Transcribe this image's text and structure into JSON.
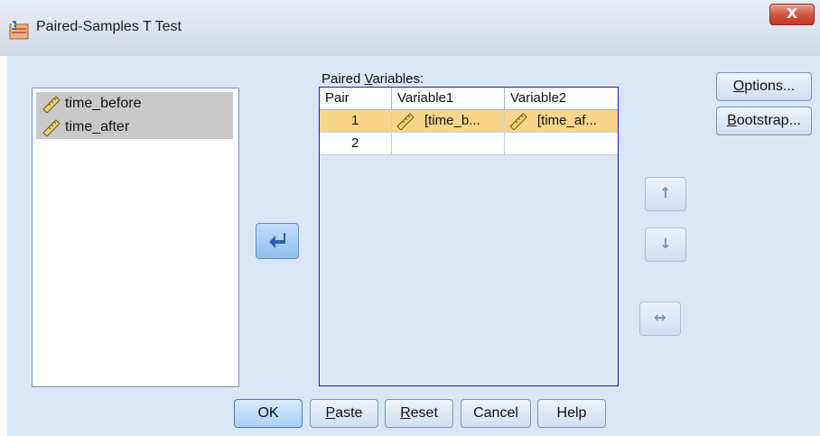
{
  "window": {
    "title": "Paired-Samples T Test",
    "close_glyph": "X"
  },
  "source_list": {
    "items": [
      {
        "label": "time_before"
      },
      {
        "label": "time_after"
      }
    ]
  },
  "paired": {
    "label_pre": "Paired ",
    "label_accel": "V",
    "label_post": "ariables:",
    "headers": [
      "Pair",
      "Variable1",
      "Variable2"
    ],
    "rows": [
      {
        "pair": "1",
        "var1": "[time_b...",
        "var2": "[time_af...",
        "selected": true
      },
      {
        "pair": "2",
        "var1": "",
        "var2": "",
        "selected": false
      }
    ]
  },
  "side_buttons": {
    "options": {
      "accel": "O",
      "rest": "ptions..."
    },
    "bootstrap": {
      "accel": "B",
      "rest": "ootstrap..."
    }
  },
  "arrows": {
    "move": "arrow-left-icon",
    "up": "↑",
    "down": "↓",
    "swap": "↔"
  },
  "footer": {
    "ok": "OK",
    "paste": {
      "accel": "P",
      "rest": "aste"
    },
    "reset": {
      "accel": "R",
      "rest": "eset"
    },
    "cancel": "Cancel",
    "help": "Help"
  },
  "colors": {
    "selected_row": "#f7d58a",
    "client_bg": "#dce7f5",
    "grid_border": "#1f1fb0"
  }
}
